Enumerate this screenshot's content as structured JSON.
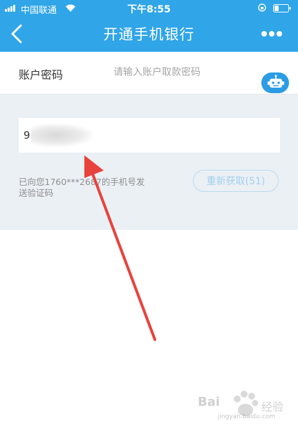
{
  "status_bar": {
    "carrier": "中国联通",
    "time": "下午8:55"
  },
  "nav": {
    "title": "开通手机银行"
  },
  "password": {
    "label": "账户密码",
    "placeholder": "请输入账户取款密码"
  },
  "verification": {
    "code_value": "9",
    "sms_notice": "已向您1760***2687的手机号发送验证码",
    "resend_label": "重新获取(51)"
  },
  "watermark": {
    "brand": "Bai",
    "suffix": "经验",
    "url": "jingyan.baidu.com"
  },
  "colors": {
    "primary": "#30a5e8",
    "background_grey": "#ebf0f5",
    "annotation_arrow": "#e8423d"
  }
}
